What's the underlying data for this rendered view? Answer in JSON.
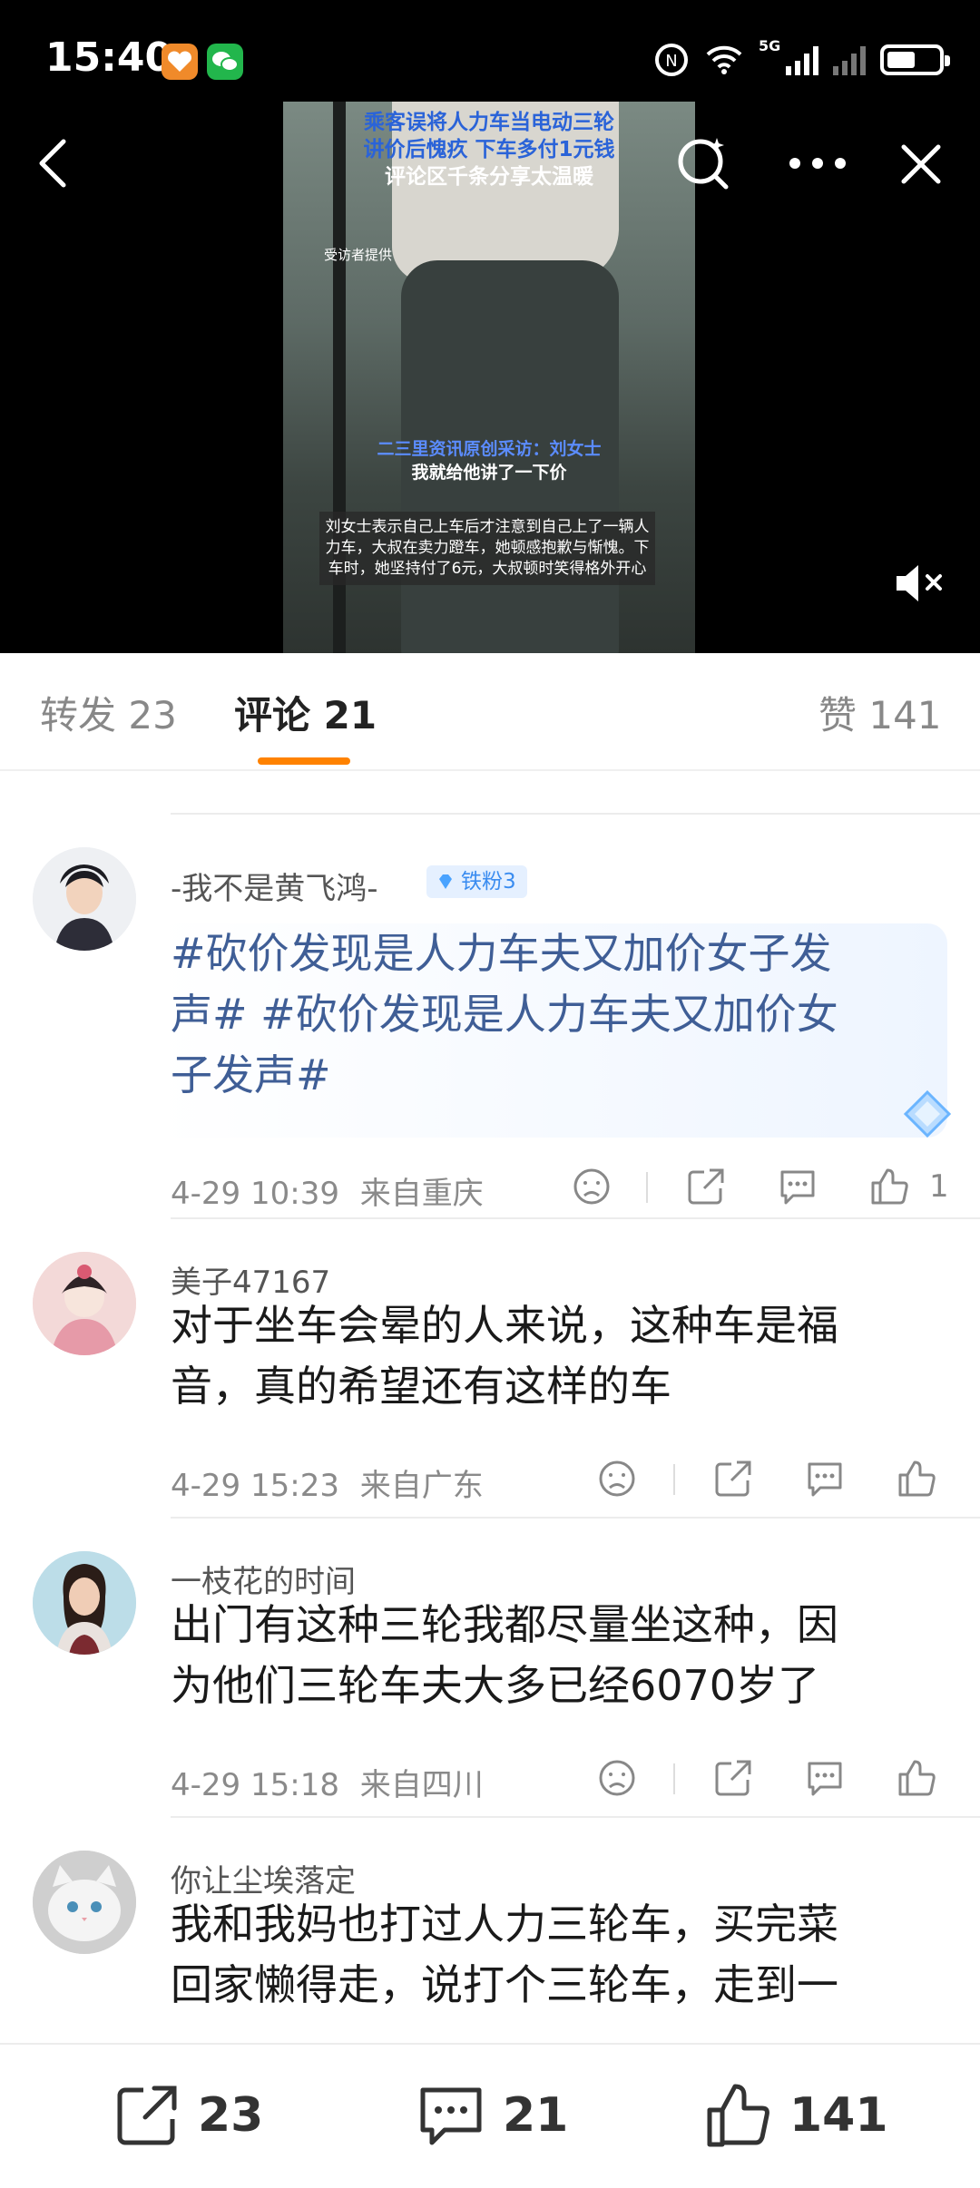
{
  "status_bar": {
    "time": "15:40",
    "network": "5G"
  },
  "video": {
    "title_line1": "乘客误将人力车当电动三轮",
    "title_line2": "讲价后愧疚 下车多付1元钱",
    "title_line3": "评论区千条分享太温暖",
    "source_note": "受访者提供",
    "caption_line1": "二三里资讯原创采访：刘女士",
    "caption_line2": "我就给他讲了一下价",
    "description": "刘女士表示自己上车后才注意到自己上了一辆人力车，大叔在卖力蹬车，她顿感抱歉与惭愧。下车时，她坚持付了6元，大叔顿时笑得格外开心"
  },
  "tabs": {
    "repost": "转发 23",
    "comments": "评论 21",
    "likes": "赞 141"
  },
  "comments": [
    {
      "name": "-我不是黄飞鸿-",
      "badge": "铁粉3",
      "text": "#砍价发现是人力车夫又加价女子发声# #砍价发现是人力车夫又加价女子发声#",
      "line1": "#砍价发现是人力车夫又加价女子发",
      "line2": "声# #砍价发现是人力车夫又加价女",
      "line3": "子发声#",
      "time": "4-29 10:39",
      "location": "来自重庆",
      "likes": "1"
    },
    {
      "name": "美子47167",
      "line1": "对于坐车会晕的人来说，这种车是福",
      "line2": "音，真的希望还有这样的车",
      "time": "4-29 15:23",
      "location": "来自广东"
    },
    {
      "name": "一枝花的时间",
      "line1": "出门有这种三轮我都尽量坐这种，因",
      "line2": "为他们三轮车夫大多已经6070岁了",
      "time": "4-29 15:18",
      "location": "来自四川"
    },
    {
      "name": "你让尘埃落定",
      "line1": "我和我妈也打过人力三轮车，买完菜",
      "line2": "回家懒得走，说打个三轮车，走到一"
    }
  ],
  "bottom_bar": {
    "repost_count": "23",
    "comment_count": "21",
    "like_count": "141"
  },
  "colors": {
    "accent_orange": "#ff8200",
    "topic_blue": "#3f5e96",
    "badge_blue": "#3a8cf0"
  }
}
